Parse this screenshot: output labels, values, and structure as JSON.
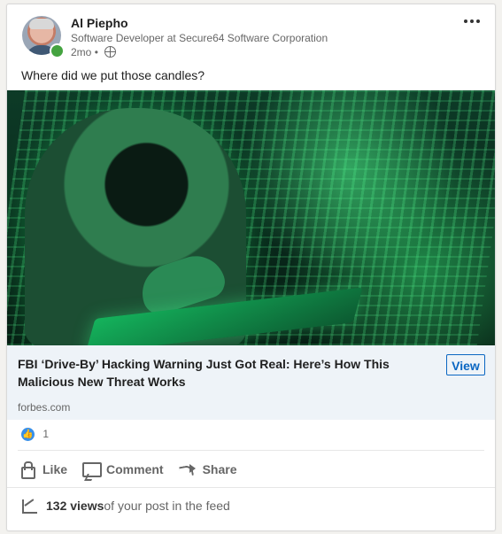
{
  "post": {
    "author": {
      "name": "Al Piepho",
      "headline": "Software Developer at Secure64 Software Corporation",
      "time": "2mo",
      "visibility_separator": "•"
    },
    "text": "Where did we put those candles?",
    "link": {
      "title": "FBI ‘Drive-By’ Hacking Warning Just Got Real: Here’s How This Malicious New Threat Works",
      "button_label": "View",
      "domain": "forbes.com"
    },
    "reactions": {
      "count": "1"
    },
    "actions": {
      "like": "Like",
      "comment": "Comment",
      "share": "Share"
    },
    "views": {
      "count_label": "132 views",
      "suffix": " of your post in the feed"
    }
  },
  "icons": {
    "more": "more-horizontal-icon",
    "visibility": "globe-icon",
    "reaction": "like-icon",
    "like": "thumb-up-icon",
    "comment": "comment-icon",
    "share": "share-icon",
    "views": "analytics-icon"
  },
  "colors": {
    "accent": "#0a66c2",
    "online_status": "#44a340",
    "reaction_blue": "#378fe9"
  }
}
